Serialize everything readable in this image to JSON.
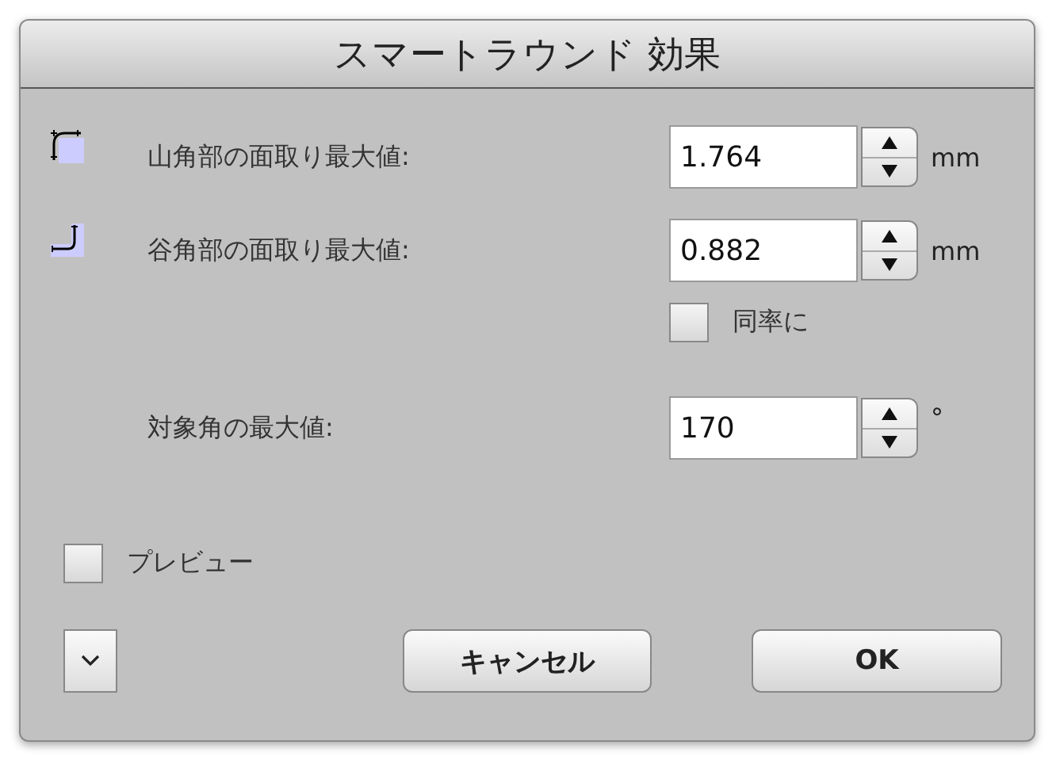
{
  "window": {
    "title": "スマートラウンド 効果"
  },
  "fields": [
    {
      "kind": "convex",
      "label": "山角部の面取り最大値:",
      "value": "1.764",
      "unit": "mm"
    },
    {
      "kind": "concave",
      "label": "谷角部の面取り最大値:",
      "value": "0.882",
      "unit": "mm"
    }
  ],
  "same_ratio": {
    "label": "同率に",
    "checked": false
  },
  "angle": {
    "label": "対象角の最大値:",
    "value": "170",
    "unit": "°"
  },
  "preview": {
    "label": "プレビュー",
    "checked": false
  },
  "buttons": [
    "キャンセル",
    "OK"
  ]
}
